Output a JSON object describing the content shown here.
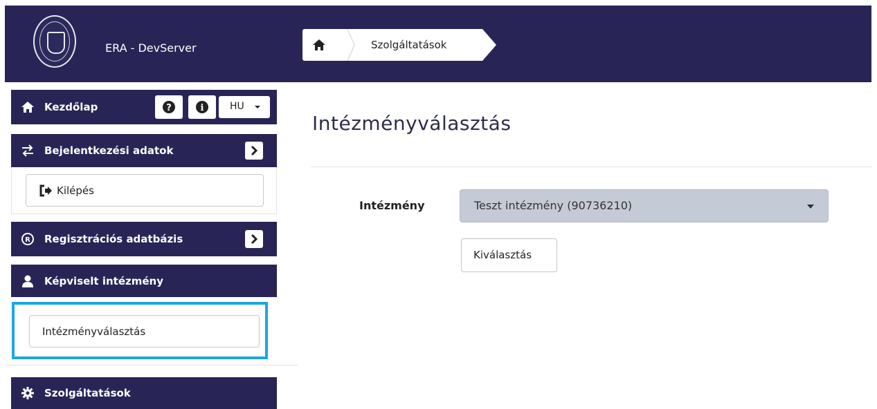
{
  "header": {
    "app_title": "ERA - DevServer",
    "background": "#282556",
    "breadcrumb": {
      "home_icon": "home-icon",
      "current": "Szolgáltatások"
    }
  },
  "sidebar": {
    "home": {
      "label": "Kezdőlap",
      "help_icon": "question-circle-icon",
      "info_icon": "info-circle-icon",
      "language": "HU"
    },
    "login_data": {
      "label": "Bejelentkezési adatok",
      "expand_icon": "chevron-right-icon"
    },
    "logout": {
      "label": "Kilépés",
      "icon": "sign-out-icon"
    },
    "registry": {
      "label": "Regisztrációs adatbázis",
      "expand_icon": "chevron-right-icon"
    },
    "represented": {
      "label": "Képviselt intézmény",
      "icon": "user-icon"
    },
    "institution_select": {
      "label": "Intézményválasztás"
    },
    "services": {
      "label": "Szolgáltatások",
      "icon": "gear-icon"
    },
    "highlight_color": "#1ea6e0"
  },
  "main": {
    "title": "Intézményválasztás",
    "field_label": "Intézmény",
    "select_value": "Teszt intézmény (90736210)",
    "submit_label": "Kiválasztás"
  }
}
